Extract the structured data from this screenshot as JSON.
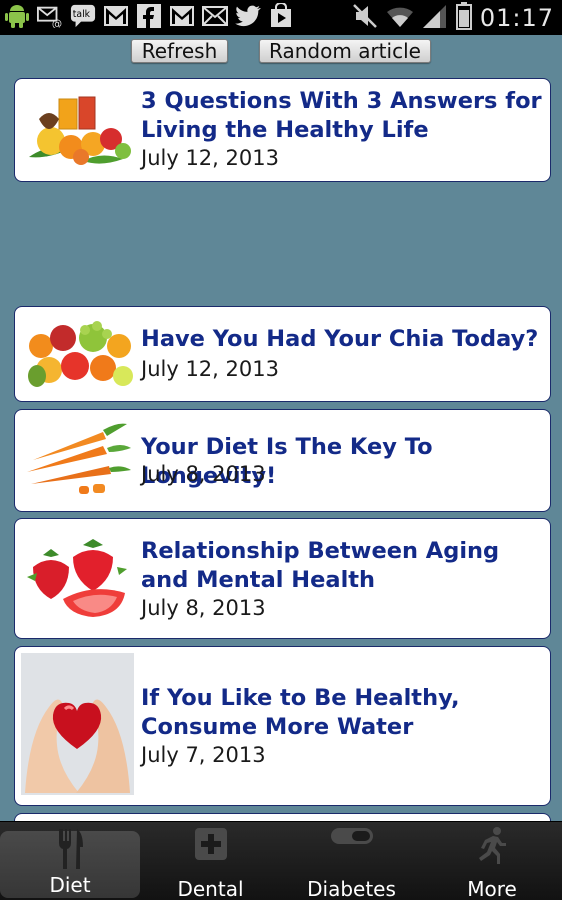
{
  "status_bar": {
    "time": "01:17",
    "notification_icons": [
      "android-icon",
      "mail-at-icon",
      "talk-icon",
      "gmail-icon",
      "facebook-icon",
      "gmail-icon",
      "mail-icon",
      "twitter-icon",
      "play-store-icon"
    ],
    "system_icons": [
      "mute-icon",
      "wifi-icon",
      "signal-icon",
      "battery-icon"
    ]
  },
  "toolbar": {
    "refresh_label": "Refresh",
    "random_label": "Random article"
  },
  "articles": [
    {
      "title": "3 Questions With 3 Answers for Living the Healthy Life",
      "date": "July 12, 2013",
      "image": "fruit-juice-image"
    },
    {
      "title": "Have You Had Your Chia Today?",
      "date": "July 12, 2013",
      "image": "fruit-pile-image"
    },
    {
      "title": "Your Diet Is The Key To Longevity!",
      "date": "July 8, 2013",
      "image": "carrots-image"
    },
    {
      "title": "Relationship Between Aging and Mental Health",
      "date": "July 8, 2013",
      "image": "strawberries-image"
    },
    {
      "title": "If You Like to Be Healthy, Consume More Water",
      "date": "July 7, 2013",
      "image": "hands-heart-image"
    }
  ],
  "bottom_nav": {
    "tabs": [
      {
        "label": "Diet",
        "icon": "fork-knife-icon",
        "active": true
      },
      {
        "label": "Dental",
        "icon": "plus-cross-icon",
        "active": false
      },
      {
        "label": "Diabetes",
        "icon": "pill-icon",
        "active": false
      },
      {
        "label": "More",
        "icon": "runner-icon",
        "active": false
      }
    ]
  },
  "colors": {
    "background": "#5f8797",
    "title_text": "#132a88",
    "card_border": "#1b2a6b",
    "status_bar": "#000000",
    "nav_bar": "#1a1a1a"
  }
}
